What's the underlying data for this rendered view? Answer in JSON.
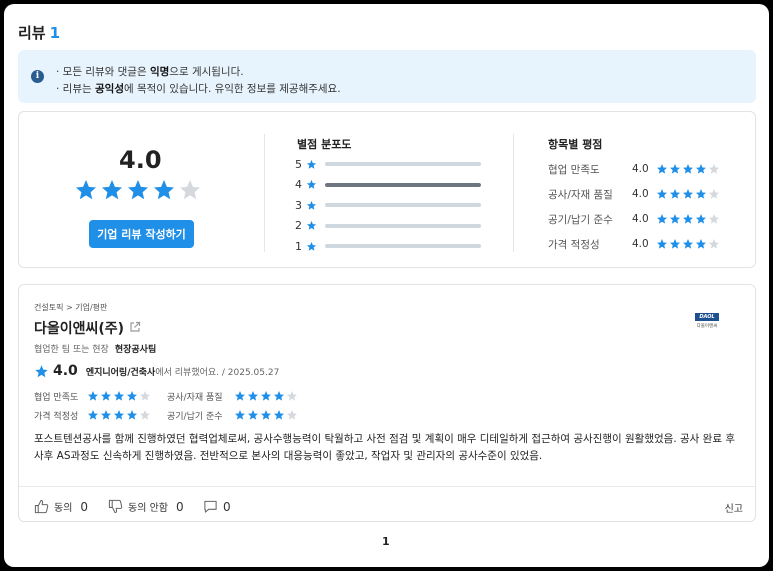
{
  "header": {
    "title": "리뷰",
    "count": "1"
  },
  "notice": {
    "line1_pre": "· 모든 리뷰와 댓글은 ",
    "line1_bold": "익명",
    "line1_post": "으로 게시됩니다.",
    "line2_pre": "· 리뷰는 ",
    "line2_bold": "공익성",
    "line2_post": "에 목적이 있습니다. 유익한 정보를 제공해주세요."
  },
  "summary": {
    "overall_score": "4.0",
    "overall_stars": 4,
    "write_button": "기업 리뷰 작성하기",
    "distribution_title": "별점 분포도",
    "distribution": [
      {
        "label": "5",
        "fraction": 0
      },
      {
        "label": "4",
        "fraction": 1
      },
      {
        "label": "3",
        "fraction": 0
      },
      {
        "label": "2",
        "fraction": 0
      },
      {
        "label": "1",
        "fraction": 0
      }
    ],
    "category_title": "항목별 평점",
    "categories": [
      {
        "label": "협업 만족도",
        "value": "4.0",
        "stars": 4
      },
      {
        "label": "공사/자재 품질",
        "value": "4.0",
        "stars": 4
      },
      {
        "label": "공기/납기 준수",
        "value": "4.0",
        "stars": 4
      },
      {
        "label": "가격 적정성",
        "value": "4.0",
        "stars": 4
      }
    ]
  },
  "review": {
    "breadcrumb": "건설토픽 > 기업/평판",
    "company": "다올이앤씨(주)",
    "logo_mark": "DAOL",
    "logo_text": "다올이앤씨",
    "team_label": "협업한 팀 또는 현장",
    "team_value": "현장공사팀",
    "score": "4.0",
    "reviewer": "엔지니어링/건축사",
    "reviewer_suffix": "에서 리뷰했어요. / 2025.05.27",
    "sub_ratings": [
      {
        "label": "협업 만족도",
        "stars": 4
      },
      {
        "label": "공사/자재 품질",
        "stars": 4
      },
      {
        "label": "가격 적정성",
        "stars": 4
      },
      {
        "label": "공기/납기 준수",
        "stars": 4
      }
    ],
    "body": "포스트텐션공사를 함께 진행하였던 협력업체로써, 공사수행능력이 탁월하고 사전 점검 및 계획이 매우 디테일하게 접근하여 공사진행이 원활했었음. 공사 완료 후 사후 AS과정도 신속하게 진행하였음. 전반적으로 본사의 대응능력이 좋았고, 작업자 및 관리자의 공사수준이 있었음.",
    "agree_label": "동의",
    "agree_count": "0",
    "disagree_label": "동의 안함",
    "disagree_count": "0",
    "comment_count": "0",
    "report_label": "신고"
  },
  "pagination": {
    "current": "1"
  },
  "colors": {
    "accent": "#1f8fe8",
    "star_empty": "#d5d9de",
    "notice_bg": "#e8f4fd"
  },
  "icons": [
    "info-icon",
    "star-icon",
    "external-link-icon",
    "thumbs-up-icon",
    "thumbs-down-icon",
    "comment-icon"
  ]
}
